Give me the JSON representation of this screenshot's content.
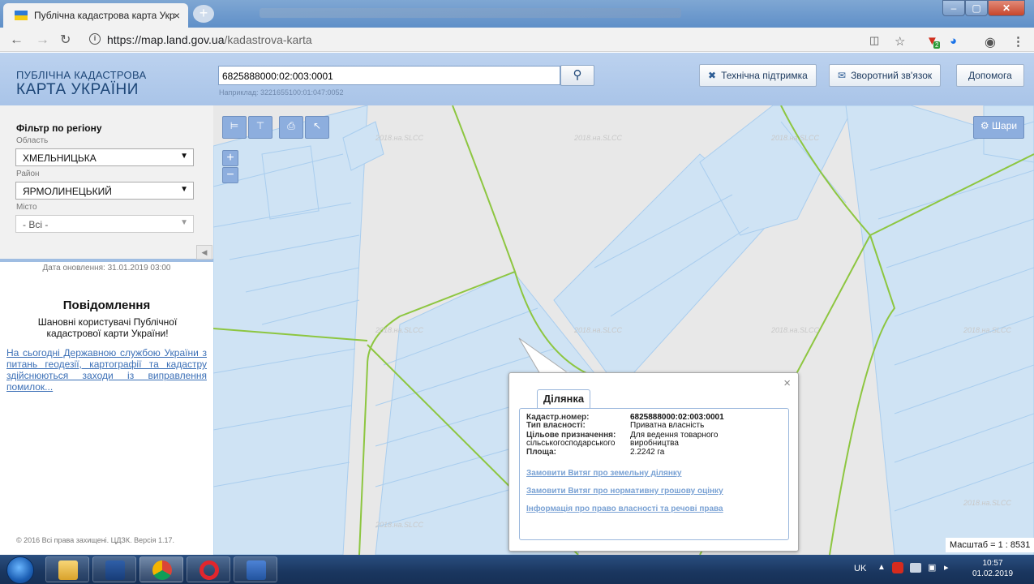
{
  "browser": {
    "tab_title": "Публічна кадастрова карта Укр",
    "tab_close": "×",
    "new_tab": "+",
    "url_host": "https://map.land.gov.ua",
    "url_path": "/kadastrova-karta",
    "ext_badge": "2"
  },
  "header": {
    "logo_line1": "ПУБЛІЧНА КАДАСТРОВА",
    "logo_line2": "КАРТА УКРАЇНИ",
    "search_value": "6825888000:02:003:0001",
    "search_hint": "Наприклад: 3221655100:01:047:0052",
    "support_label": "Технічна підтримка",
    "feedback_label": "Зворотний зв'язок",
    "help_label": "Допомога"
  },
  "sidebar": {
    "filter_title": "Фільтр по регіону",
    "oblast_label": "Область",
    "oblast_value": "ХМЕЛЬНИЦЬКА",
    "rayon_label": "Район",
    "rayon_value": "ЯРМОЛИНЕЦЬКИЙ",
    "city_label": "Місто",
    "city_value": "- Всі -",
    "update_date": "Дата оновлення: 31.01.2019 03:00",
    "msg_title": "Повідомлення",
    "msg_text": "Шановні користувачі Публічної кадастрової карти України!",
    "msg_link": "На сьогодні Державною службою України з питань геодезії, картографії та кадастру здійснюються заходи із виправлення помилок...",
    "copyright": "© 2016 Всі права захищені. ЦДЗК. Версія 1.17."
  },
  "map": {
    "layers_label": "Шари",
    "zoom_in": "+",
    "zoom_out": "−",
    "watermark": "2018.на.SLCC",
    "scale_text": "Масштаб = 1 : 8531"
  },
  "popup": {
    "tab_label": "Ділянка",
    "close": "×",
    "rows": [
      {
        "key": "Кадастр.номер:",
        "value": "6825888000:02:003:0001"
      },
      {
        "key": "Тип власності:",
        "value": "Приватна власність"
      },
      {
        "key": "Цільове призначення:",
        "value": "Для ведення товарного"
      },
      {
        "key": "сільськогосподарського",
        "value": "виробництва"
      },
      {
        "key": "Площа:",
        "value": "2.2242 га"
      }
    ],
    "link1": "Замовити Витяг про земельну ділянку",
    "link2": "Замовити Витяг про нормативну грошову оцінку",
    "link3": "Інформація про право власності та речові права"
  },
  "taskbar": {
    "lang": "UK",
    "time": "10:57",
    "date": "01.02.2019"
  }
}
